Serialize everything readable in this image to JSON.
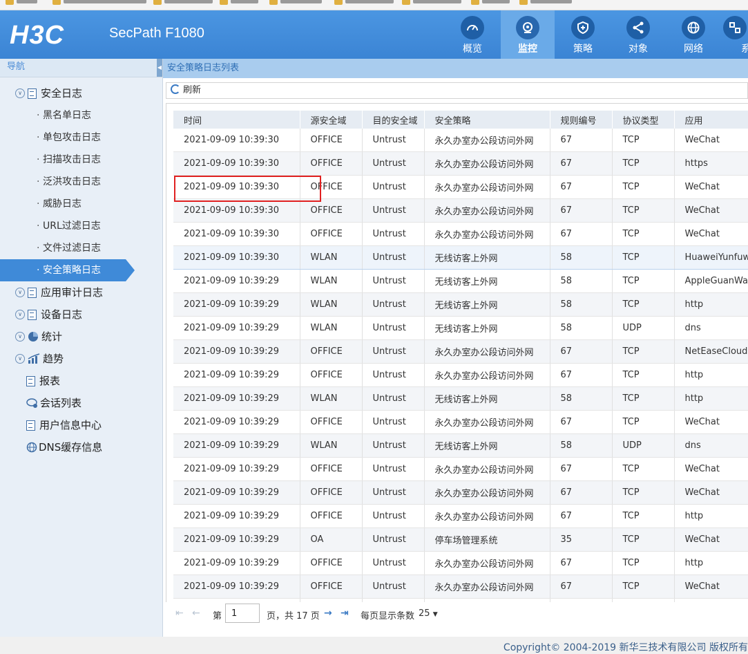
{
  "header": {
    "brand": "H3C",
    "product": "SecPath F1080",
    "nav": [
      {
        "label": "概览",
        "icon": "gauge-icon"
      },
      {
        "label": "监控",
        "icon": "webcam-icon",
        "active": true
      },
      {
        "label": "策略",
        "icon": "shield-icon"
      },
      {
        "label": "对象",
        "icon": "share-icon"
      },
      {
        "label": "网络",
        "icon": "globe-icon"
      },
      {
        "label": "系",
        "icon": "system-icon"
      }
    ]
  },
  "sidebar": {
    "title": "导航",
    "groups": [
      {
        "label": "安全日志"
      },
      {
        "label": "应用审计日志"
      },
      {
        "label": "设备日志"
      },
      {
        "label": "统计"
      },
      {
        "label": "趋势"
      },
      {
        "label": "报表"
      },
      {
        "label": "会话列表"
      },
      {
        "label": "用户信息中心"
      },
      {
        "label": "DNS缓存信息"
      }
    ],
    "items": [
      {
        "label": "黑名单日志"
      },
      {
        "label": "单包攻击日志"
      },
      {
        "label": "扫描攻击日志"
      },
      {
        "label": "泛洪攻击日志"
      },
      {
        "label": "威胁日志"
      },
      {
        "label": "URL过滤日志"
      },
      {
        "label": "文件过滤日志"
      },
      {
        "label": "安全策略日志",
        "active": true
      }
    ]
  },
  "main": {
    "title": "安全策略日志列表",
    "refresh_label": "刷新",
    "columns": [
      "时间",
      "源安全域",
      "目的安全域",
      "安全策略",
      "规则编号",
      "协议类型",
      "应用"
    ],
    "rows": [
      [
        "2021-09-09 10:39:30",
        "OFFICE",
        "Untrust",
        "永久办室办公段访问外网",
        "67",
        "TCP",
        "WeChat"
      ],
      [
        "2021-09-09 10:39:30",
        "OFFICE",
        "Untrust",
        "永久办室办公段访问外网",
        "67",
        "TCP",
        "https"
      ],
      [
        "2021-09-09 10:39:30",
        "OFFICE",
        "Untrust",
        "永久办室办公段访问外网",
        "67",
        "TCP",
        "WeChat"
      ],
      [
        "2021-09-09 10:39:30",
        "OFFICE",
        "Untrust",
        "永久办室办公段访问外网",
        "67",
        "TCP",
        "WeChat"
      ],
      [
        "2021-09-09 10:39:30",
        "OFFICE",
        "Untrust",
        "永久办室办公段访问外网",
        "67",
        "TCP",
        "WeChat"
      ],
      [
        "2021-09-09 10:39:30",
        "WLAN",
        "Untrust",
        "无线访客上外网",
        "58",
        "TCP",
        "HuaweiYunfuwu"
      ],
      [
        "2021-09-09 10:39:29",
        "WLAN",
        "Untrust",
        "无线访客上外网",
        "58",
        "TCP",
        "AppleGuanWang"
      ],
      [
        "2021-09-09 10:39:29",
        "WLAN",
        "Untrust",
        "无线访客上外网",
        "58",
        "TCP",
        "http"
      ],
      [
        "2021-09-09 10:39:29",
        "WLAN",
        "Untrust",
        "无线访客上外网",
        "58",
        "UDP",
        "dns"
      ],
      [
        "2021-09-09 10:39:29",
        "OFFICE",
        "Untrust",
        "永久办室办公段访问外网",
        "67",
        "TCP",
        "NetEaseCloudMusic"
      ],
      [
        "2021-09-09 10:39:29",
        "OFFICE",
        "Untrust",
        "永久办室办公段访问外网",
        "67",
        "TCP",
        "http"
      ],
      [
        "2021-09-09 10:39:29",
        "WLAN",
        "Untrust",
        "无线访客上外网",
        "58",
        "TCP",
        "http"
      ],
      [
        "2021-09-09 10:39:29",
        "OFFICE",
        "Untrust",
        "永久办室办公段访问外网",
        "67",
        "TCP",
        "WeChat"
      ],
      [
        "2021-09-09 10:39:29",
        "WLAN",
        "Untrust",
        "无线访客上外网",
        "58",
        "UDP",
        "dns"
      ],
      [
        "2021-09-09 10:39:29",
        "OFFICE",
        "Untrust",
        "永久办室办公段访问外网",
        "67",
        "TCP",
        "WeChat"
      ],
      [
        "2021-09-09 10:39:29",
        "OFFICE",
        "Untrust",
        "永久办室办公段访问外网",
        "67",
        "TCP",
        "WeChat"
      ],
      [
        "2021-09-09 10:39:29",
        "OFFICE",
        "Untrust",
        "永久办室办公段访问外网",
        "67",
        "TCP",
        "http"
      ],
      [
        "2021-09-09 10:39:29",
        "OA",
        "Untrust",
        "停车场管理系统",
        "35",
        "TCP",
        "WeChat"
      ],
      [
        "2021-09-09 10:39:29",
        "OFFICE",
        "Untrust",
        "永久办室办公段访问外网",
        "67",
        "TCP",
        "http"
      ],
      [
        "2021-09-09 10:39:29",
        "OFFICE",
        "Untrust",
        "永久办室办公段访问外网",
        "67",
        "TCP",
        "WeChat"
      ],
      [
        "2021-09-09 10:39:29",
        "WLAN",
        "Untrust",
        "无线访客上外网",
        "58",
        "TCP",
        "WeChat"
      ]
    ],
    "pager": {
      "page_prefix": "第",
      "page_value": "1",
      "page_suffix": "页，共 17 页",
      "per_page_label": "每页显示条数",
      "per_page_value": "25"
    }
  },
  "footer": {
    "copyright": "Copyright© 2004-2019 新华三技术有限公司 版权所有"
  }
}
